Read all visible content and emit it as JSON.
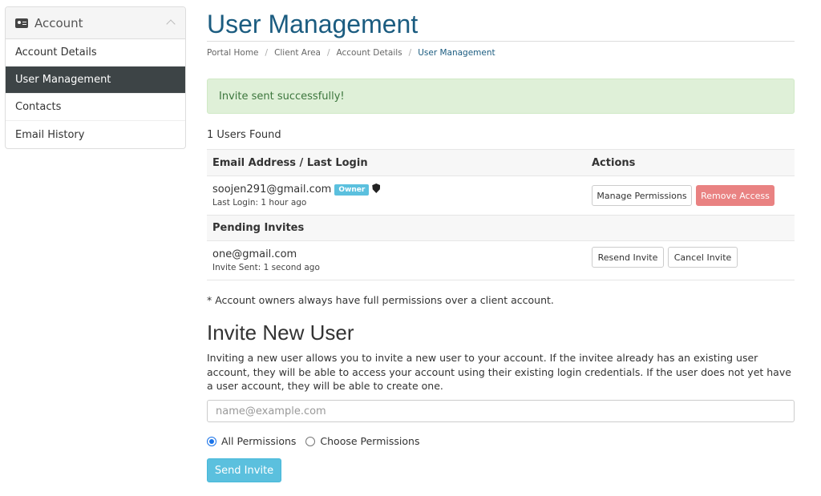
{
  "sidebar": {
    "title": "Account",
    "items": [
      {
        "label": "Account Details"
      },
      {
        "label": "User Management"
      },
      {
        "label": "Contacts"
      },
      {
        "label": "Email History"
      }
    ]
  },
  "page": {
    "title": "User Management",
    "breadcrumb": [
      "Portal Home",
      "Client Area",
      "Account Details",
      "User Management"
    ]
  },
  "alert": {
    "text": "Invite sent successfully!"
  },
  "users_found": "1 Users Found",
  "table": {
    "col_email": "Email Address / Last Login",
    "col_actions": "Actions",
    "user": {
      "email": "soojen291@gmail.com",
      "badge": "Owner",
      "last_login": "Last Login: 1 hour ago",
      "manage_label": "Manage Permissions",
      "remove_label": "Remove Access"
    },
    "pending_header": "Pending Invites",
    "invite": {
      "email": "one@gmail.com",
      "sent": "Invite Sent: 1 second ago",
      "resend_label": "Resend Invite",
      "cancel_label": "Cancel Invite"
    }
  },
  "note": "* Account owners always have full permissions over a client account.",
  "invite_form": {
    "title": "Invite New User",
    "description": "Inviting a new user allows you to invite a new user to your account. If the invitee already has an existing user account, they will be able to access your account using their existing login credentials. If the user does not yet have a user account, they will be able to create one.",
    "email_placeholder": "name@example.com",
    "email_value": "",
    "radio_all": "All Permissions",
    "radio_choose": "Choose Permissions",
    "selected": "All Permissions",
    "send_label": "Send Invite"
  },
  "colors": {
    "title_blue": "#1b5c80",
    "active_nav": "#3d4446",
    "success_bg": "#dff0d8",
    "info": "#5bc0de",
    "danger": "#e98282"
  }
}
